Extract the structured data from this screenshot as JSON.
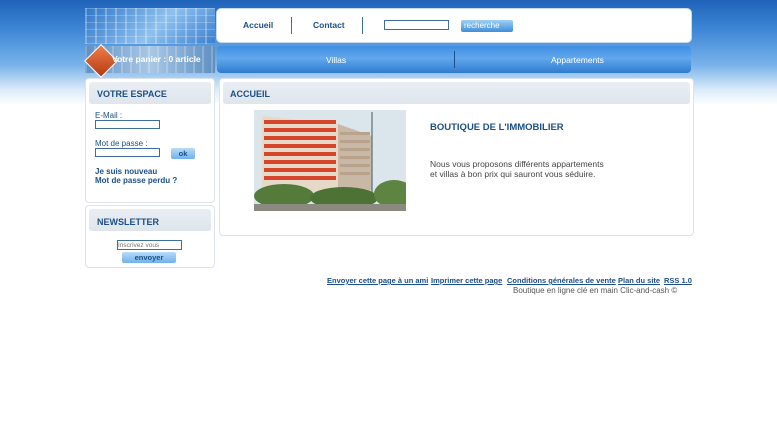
{
  "header": {
    "cart_text": "Votre panier : 0 article"
  },
  "topnav": {
    "home_label": "Accueil",
    "contact_label": "Contact",
    "search_value": "",
    "search_button": "recherche"
  },
  "mainnav": {
    "items": [
      "Villas",
      "Appartements"
    ]
  },
  "sidebar": {
    "account": {
      "title": "VOTRE ESPACE",
      "email_label": "E-Mail :",
      "password_label": "Mot de passe :",
      "ok_label": "ok",
      "new_user_link": "Je suis nouveau",
      "forgot_password_link": "Mot de passe perdu ?"
    },
    "newsletter": {
      "title": "NEWSLETTER",
      "placeholder": "Inscrivez vous",
      "submit_label": "envoyer"
    }
  },
  "main": {
    "panel_title": "ACCUEIL",
    "heading": "BOUTIQUE DE L'IMMOBILIER",
    "text_lines": [
      "Nous vous proposons différents appartements",
      "et villas à bon prix qui sauront vous séduire."
    ]
  },
  "footer": {
    "links": [
      "Envoyer cette page à un ami",
      "Imprimer cette page",
      "Conditions générales de vente",
      "Plan du site",
      "RSS 1.0"
    ],
    "note": "Boutique en ligne clé en main Clic-and-cash ©"
  },
  "colors": {
    "accent": "#1b4f86",
    "nav_blue": "#3f8ee2",
    "background_band": "#3d86d6"
  }
}
